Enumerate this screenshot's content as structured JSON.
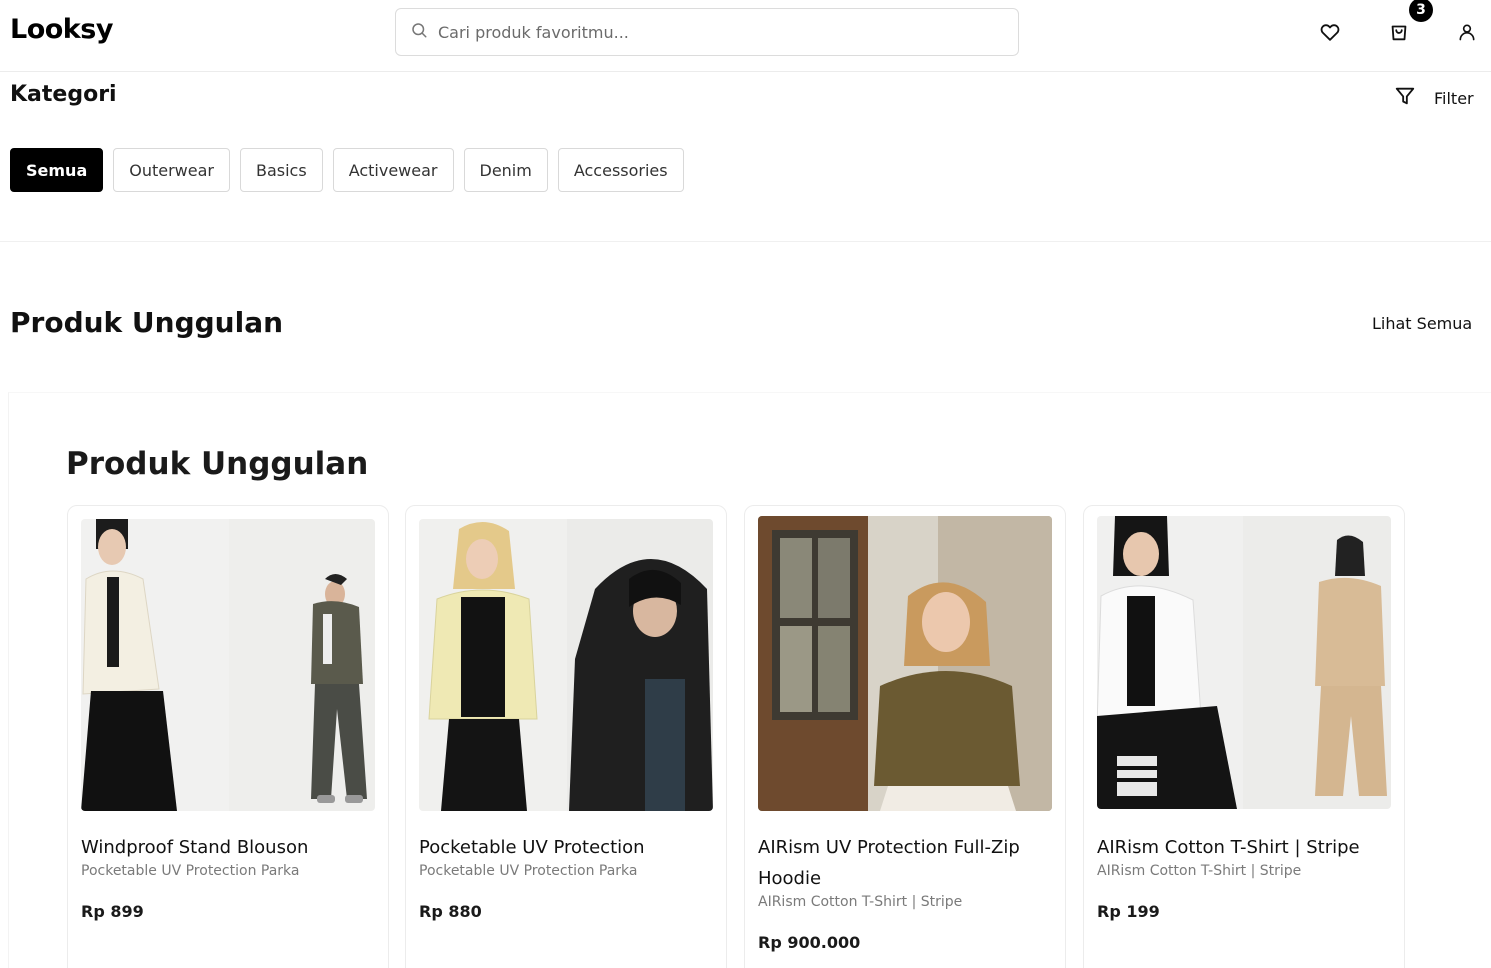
{
  "header": {
    "logo": "Looksy",
    "search_placeholder": "Cari produk favoritmu...",
    "cart_count": "3"
  },
  "categories": {
    "title": "Kategori",
    "filter_label": "Filter",
    "items": [
      "Semua",
      "Outerwear",
      "Basics",
      "Activewear",
      "Denim",
      "Accessories"
    ],
    "active": "Semua"
  },
  "featured": {
    "title": "Produk Unggulan",
    "see_all": "Lihat Semua",
    "inner_title": "Produk Unggulan",
    "products": [
      {
        "name": "Windproof Stand Blouson",
        "subtitle": "Pocketable UV Protection Parka",
        "price": "Rp 899"
      },
      {
        "name": "Pocketable UV Protection",
        "subtitle": "Pocketable UV Protection Parka",
        "price": "Rp 880"
      },
      {
        "name": "AIRism UV Protection Full-Zip Hoodie",
        "subtitle": "AIRism Cotton T-Shirt | Stripe",
        "price": "Rp 900.000"
      },
      {
        "name": "AIRism Cotton T-Shirt | Stripe",
        "subtitle": "AIRism Cotton T-Shirt | Stripe",
        "price": "Rp 199"
      }
    ]
  },
  "colors": {
    "accent": "#000000",
    "border": "#d9d9d9",
    "muted": "#7a7a7a"
  }
}
